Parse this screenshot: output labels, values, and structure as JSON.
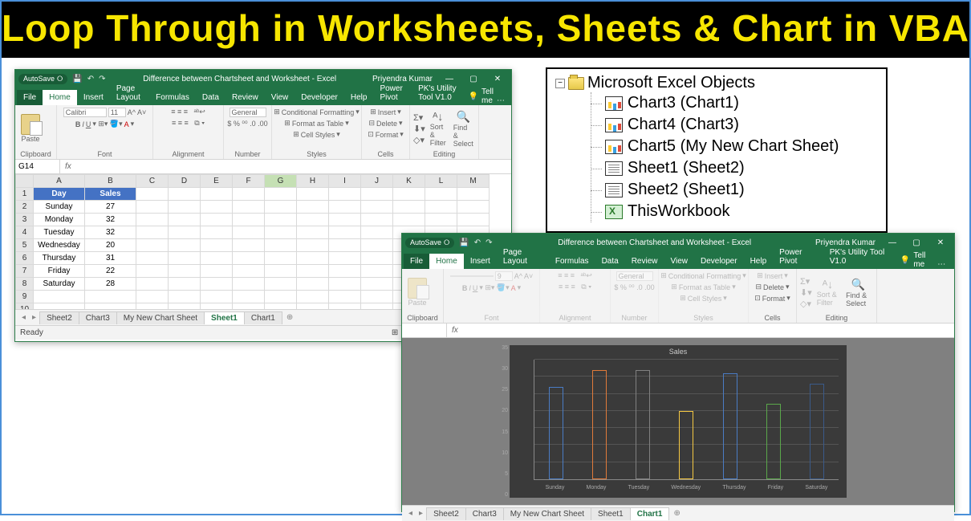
{
  "title_banner": "Loop Through in Worksheets, Sheets & Chart in VBA",
  "excel1": {
    "autosave": "AutoSave",
    "doc_title": "Difference between Chartsheet and Worksheet - Excel",
    "user": "Priyendra Kumar",
    "menu": [
      "File",
      "Home",
      "Insert",
      "Page Layout",
      "Formulas",
      "Data",
      "Review",
      "View",
      "Developer",
      "Help",
      "Power Pivot",
      "PK's Utility Tool V1.0"
    ],
    "active_menu": "Home",
    "tell_me": "Tell me",
    "ribbon_groups": {
      "clipboard": {
        "label": "Clipboard",
        "paste": "Paste"
      },
      "font": {
        "label": "Font",
        "name": "Calibri",
        "size": "11"
      },
      "alignment": {
        "label": "Alignment"
      },
      "number": {
        "label": "Number",
        "format": "General"
      },
      "styles": {
        "label": "Styles",
        "cond": "Conditional Formatting",
        "table": "Format as Table",
        "cell": "Cell Styles"
      },
      "cells": {
        "label": "Cells",
        "insert": "Insert",
        "delete": "Delete",
        "format": "Format"
      },
      "editing": {
        "label": "Editing",
        "sort": "Sort & Filter",
        "find": "Find & Select"
      }
    },
    "name_box": "G14",
    "columns": [
      "A",
      "B",
      "C",
      "D",
      "E",
      "F",
      "G",
      "H",
      "I",
      "J",
      "K",
      "L",
      "M"
    ],
    "headers": {
      "col_a": "Day",
      "col_b": "Sales"
    },
    "rows": [
      {
        "n": "2",
        "a": "Sunday",
        "b": "27"
      },
      {
        "n": "3",
        "a": "Monday",
        "b": "32"
      },
      {
        "n": "4",
        "a": "Tuesday",
        "b": "32"
      },
      {
        "n": "5",
        "a": "Wednesday",
        "b": "20"
      },
      {
        "n": "6",
        "a": "Thursday",
        "b": "31"
      },
      {
        "n": "7",
        "a": "Friday",
        "b": "22"
      },
      {
        "n": "8",
        "a": "Saturday",
        "b": "28"
      }
    ],
    "sheet_tabs": [
      "Sheet2",
      "Chart3",
      "My New Chart Sheet",
      "Sheet1",
      "Chart1"
    ],
    "active_sheet": "Sheet1",
    "status": "Ready"
  },
  "excel2": {
    "autosave": "AutoSave",
    "doc_title": "Difference between Chartsheet and Worksheet - Excel",
    "user": "Priyendra Kumar",
    "menu": [
      "File",
      "Home",
      "Insert",
      "Page Layout",
      "Formulas",
      "Data",
      "Review",
      "View",
      "Developer",
      "Help",
      "Power Pivot",
      "PK's Utility Tool V1.0"
    ],
    "active_menu": "Home",
    "tell_me": "Tell me",
    "ribbon_groups": {
      "clipboard": {
        "label": "Clipboard",
        "paste": "Paste"
      },
      "font": {
        "label": "Font",
        "name": "",
        "size": "9"
      },
      "alignment": {
        "label": "Alignment"
      },
      "number": {
        "label": "Number",
        "format": "General"
      },
      "styles": {
        "label": "Styles",
        "cond": "Conditional Formatting",
        "table": "Format as Table",
        "cell": "Cell Styles"
      },
      "cells": {
        "label": "Cells",
        "insert": "Insert",
        "delete": "Delete",
        "format": "Format"
      },
      "editing": {
        "label": "Editing",
        "sort": "Sort & Filter",
        "find": "Find & Select"
      }
    },
    "sheet_tabs": [
      "Sheet2",
      "Chart3",
      "My New Chart Sheet",
      "Sheet1",
      "Chart1"
    ],
    "active_sheet": "Chart1"
  },
  "chart_data": {
    "type": "bar",
    "title": "Sales",
    "categories": [
      "Sunday",
      "Monday",
      "Tuesday",
      "Wednesday",
      "Thursday",
      "Friday",
      "Saturday"
    ],
    "values": [
      27,
      32,
      32,
      20,
      31,
      22,
      28
    ],
    "colors": [
      "#4a7cc4",
      "#e07a3a",
      "#808080",
      "#f5c842",
      "#4a7cc4",
      "#5aa84a",
      "#3a5a8a"
    ],
    "ylim": [
      0,
      35
    ],
    "yticks": [
      0,
      5,
      10,
      15,
      20,
      25,
      30,
      35
    ]
  },
  "vba_tree": {
    "root": "Microsoft Excel Objects",
    "items": [
      {
        "type": "chart",
        "label": "Chart3 (Chart1)"
      },
      {
        "type": "chart",
        "label": "Chart4 (Chart3)"
      },
      {
        "type": "chart",
        "label": "Chart5 (My New Chart Sheet)"
      },
      {
        "type": "sheet",
        "label": "Sheet1 (Sheet2)"
      },
      {
        "type": "sheet",
        "label": "Sheet2 (Sheet1)"
      },
      {
        "type": "workbook",
        "label": "ThisWorkbook"
      }
    ]
  }
}
